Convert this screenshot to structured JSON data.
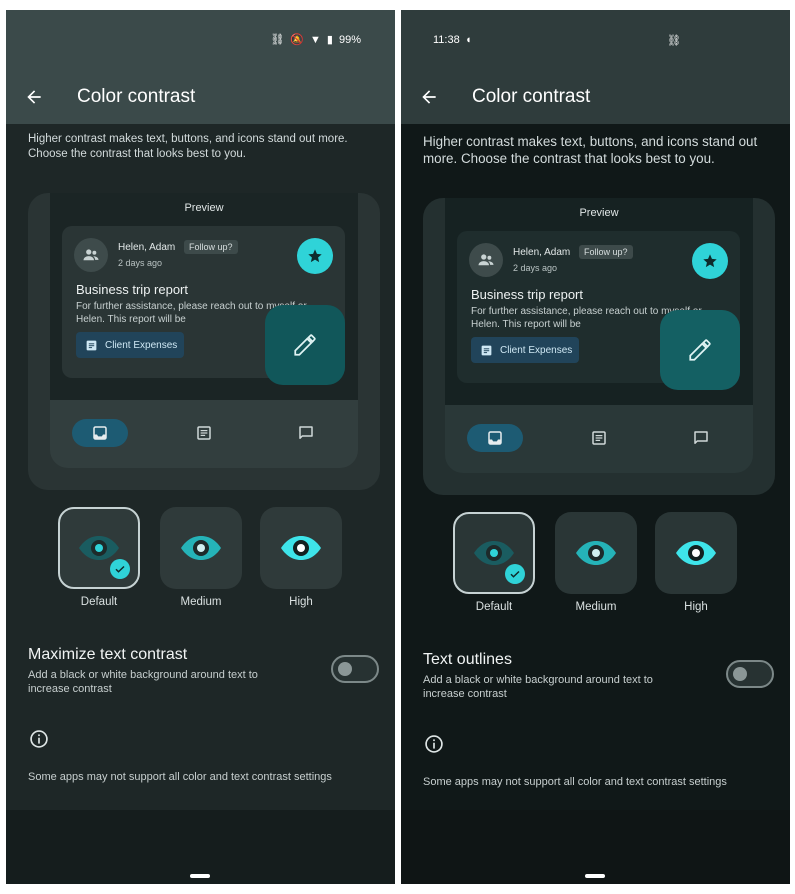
{
  "left": {
    "status": {
      "battery": "99%"
    },
    "title": "Color contrast",
    "description": "Higher contrast makes text, buttons, and icons stand out more. Choose the contrast that looks best to you.",
    "preview": {
      "label": "Preview",
      "sender": "Helen, Adam",
      "chip": "Follow up?",
      "date": "2 days ago",
      "subject": "Business trip report",
      "snippet": "For further assistance, please reach out to myself or Helen. This report will be",
      "attachment": "Client Expenses"
    },
    "options": [
      "Default",
      "Medium",
      "High"
    ],
    "setting": {
      "title": "Maximize text contrast",
      "subtitle": "Add a black or white background around text to increase contrast"
    },
    "note": "Some apps may not support all color and text contrast settings"
  },
  "right": {
    "status": {
      "time": "11:38"
    },
    "title": "Color contrast",
    "description": "Higher contrast makes text, buttons, and icons stand out more. Choose the contrast that looks best to you.",
    "preview": {
      "label": "Preview",
      "sender": "Helen, Adam",
      "chip": "Follow up?",
      "date": "2 days ago",
      "subject": "Business trip report",
      "snippet": "For further assistance, please reach out to myself or Helen. This report will be",
      "attachment": "Client Expenses"
    },
    "options": [
      "Default",
      "Medium",
      "High"
    ],
    "setting": {
      "title": "Text outlines",
      "subtitle": "Add a black or white background around text to increase contrast"
    },
    "note": "Some apps may not support all color and text contrast settings"
  },
  "colors": {
    "accent": "#2fd3d8",
    "selected_border": "#c6d2d3"
  }
}
